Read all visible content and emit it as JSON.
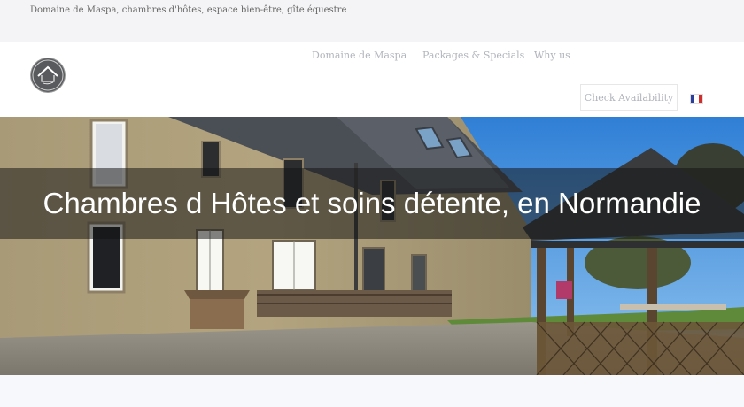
{
  "topbar": {
    "tagline": "Domaine de Maspa, chambres d'hôtes, espace bien-être, gîte équestre"
  },
  "nav": {
    "logo_icon": "house-logo-icon",
    "items": [
      {
        "label": "Domaine de Maspa"
      },
      {
        "label": "Packages & Specials"
      },
      {
        "label": "Why us"
      }
    ],
    "cta": {
      "label": "Check Availability"
    },
    "language_icon": "france-flag-icon"
  },
  "hero": {
    "title": "Chambres d Hôtes et soins détente, en Normandie",
    "image": "stone-farmhouse-with-gazebo-photo"
  },
  "colors": {
    "nav_text": "#b0b4bb",
    "banner_overlay": "rgba(20,20,20,0.52)",
    "flag_blue": "#2a3f9d",
    "flag_red": "#d22d2d"
  }
}
